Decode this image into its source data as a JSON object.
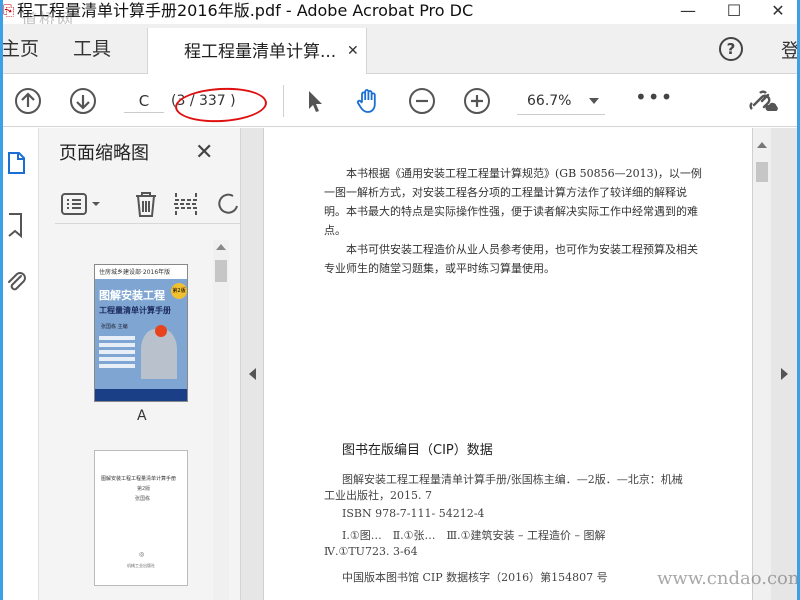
{
  "window": {
    "title": "程工程量清单计算手册2016年版.pdf - Adobe Acrobat Pro DC",
    "watermark_top": "道桥网",
    "minimize": "—",
    "maximize": "☐",
    "close": "✕"
  },
  "tabs": {
    "home": "主页",
    "tools": "工具",
    "document": "程工程量清单计算...",
    "help": "?",
    "login": "登"
  },
  "toolbar": {
    "page_input": "C",
    "page_total": "(3 / 337 )",
    "zoom": "66.7%",
    "more": "•••"
  },
  "thumbnail_panel": {
    "title": "页面缩略图",
    "close": "✕",
    "thumbnails": [
      {
        "label": "A",
        "cover_top": "住房城乡建设部·2016年版",
        "cover_title": "图解安装工程",
        "cover_subtitle": "工程量清单计算手册",
        "cover_edition": "第2版",
        "cover_author": "张国栋 主编"
      },
      {
        "label": "",
        "title": "图解安装工程工程量清单计算手册",
        "subtitle": "第2版",
        "author": "张国栋",
        "publisher": "机械工业出版社"
      }
    ]
  },
  "document": {
    "para1": "本书根据《通用安装工程工程量计算规范》(GB 50856—2013)，以一例一图一解析方式，对安装工程各分项的工程量计算方法作了较详细的解释说明。本书最大的特点是实际操作性强，便于读者解决实际工作中经常遇到的难点。",
    "para2": "本书可供安装工程造价从业人员参考使用，也可作为安装工程预算及相关专业师生的随堂习题集，或平时练习算量使用。",
    "cip_title": "图书在版编目（CIP）数据",
    "cip_line1": "图解安装工程工程量清单计算手册/张国栋主编．—2版．—北京：机械",
    "cip_line2": "工业出版社，2015. 7",
    "cip_line3": "ISBN 978-7-111- 54212-4",
    "cip_line4": "Ⅰ.①图…　Ⅱ.①张…　Ⅲ.①建筑安装 – 工程造价 – 图解",
    "cip_line5": "Ⅳ.①TU723. 3-64",
    "cip_line6": "中国版本图书馆 CIP 数据核字（2016）第154807 号"
  },
  "watermark_bottom": "www.cndao.com",
  "colors": {
    "window_border": "#3aa0e8",
    "accent_blue": "#1a6fd4",
    "annotation_red": "#e01010",
    "cover_blue": "#7fa6d2"
  }
}
